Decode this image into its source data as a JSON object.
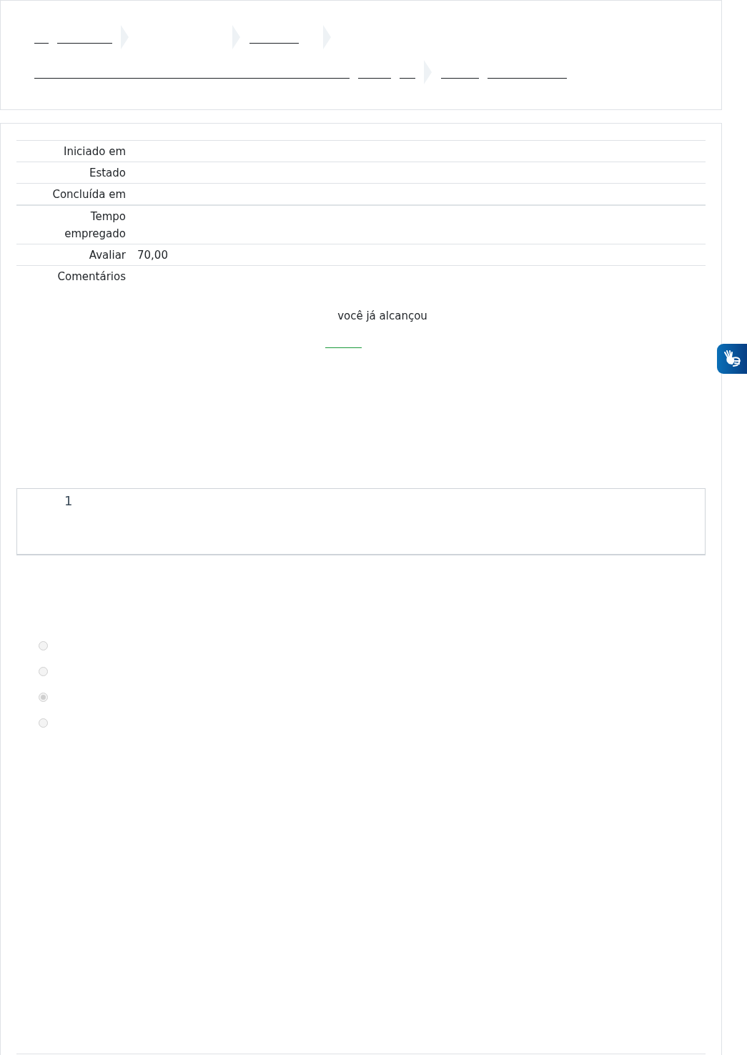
{
  "summary": {
    "rows": [
      {
        "label": "Iniciado em"
      },
      {
        "label": "Estado"
      },
      {
        "label": "Concluída em"
      },
      {
        "label": "Tempo empregado"
      },
      {
        "label": "Avaliar",
        "value": "70,00"
      },
      {
        "label": "Comentários"
      }
    ]
  },
  "feedback": {
    "text": "você já alcançou"
  },
  "question": {
    "number": "1",
    "options": [
      {
        "selected": false
      },
      {
        "selected": false
      },
      {
        "selected": true
      },
      {
        "selected": false
      }
    ]
  }
}
